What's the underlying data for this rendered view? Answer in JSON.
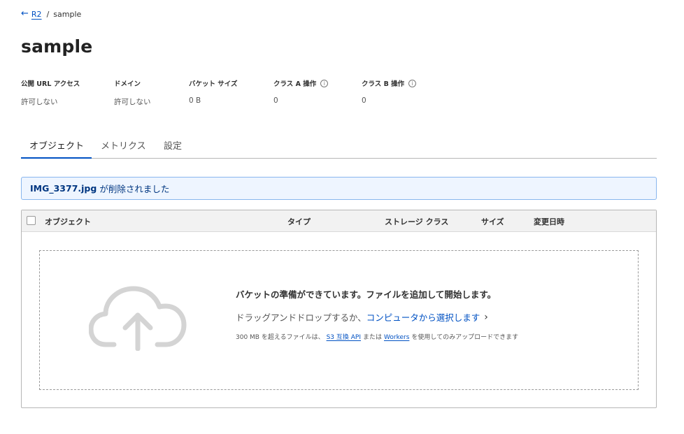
{
  "breadcrumb": {
    "back_icon": "arrow-left-icon",
    "root": "R2",
    "separator": "/",
    "current": "sample"
  },
  "page_title": "sample",
  "stats": [
    {
      "label": "公開 URL アクセス",
      "value": "許可しない"
    },
    {
      "label": "ドメイン",
      "value": "許可しない"
    },
    {
      "label": "バケット サイズ",
      "value": "0 B"
    },
    {
      "label": "クラス A 操作",
      "value": "0",
      "info_icon": "i"
    },
    {
      "label": "クラス B 操作",
      "value": "0",
      "info_icon": "i"
    }
  ],
  "tabs": [
    {
      "label": "オブジェクト",
      "active": true
    },
    {
      "label": "メトリクス",
      "active": false
    },
    {
      "label": "設定",
      "active": false
    }
  ],
  "alert": {
    "file": "IMG_3377.jpg",
    "message": "が削除されました"
  },
  "table": {
    "columns": [
      "オブジェクト",
      "タイプ",
      "ストレージ クラス",
      "サイズ",
      "変更日時"
    ]
  },
  "dropzone": {
    "icon": "cloud-upload-icon",
    "title": "バケットの準備ができています。ファイルを追加して開始します。",
    "line_prefix": "ドラッグアンドドロップするか、",
    "line_link": "コンピュータから選択します",
    "chevron": "›",
    "note_prefix": "300 MB を超えるファイルは、",
    "note_link1": "S3 互換 API",
    "note_mid": "または",
    "note_link2": "Workers",
    "note_suffix": "を使用してのみアップロードできます"
  },
  "colors": {
    "accent": "#0051c3",
    "alert_bg": "#eef5ff",
    "alert_border": "#88b6ee",
    "alert_text": "#003681"
  }
}
